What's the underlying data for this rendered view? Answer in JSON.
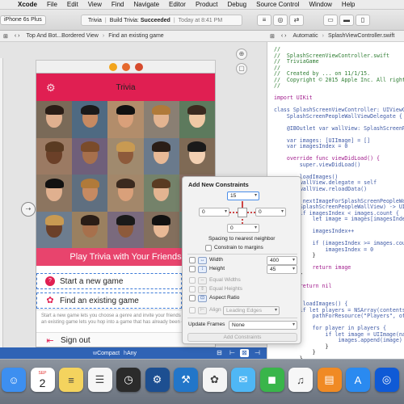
{
  "menubar": {
    "items": [
      "Xcode",
      "File",
      "Edit",
      "View",
      "Find",
      "Navigate",
      "Editor",
      "Product",
      "Debug",
      "Source Control",
      "Window",
      "Help"
    ]
  },
  "toolbar": {
    "scheme": "iPhone 6s Plus",
    "activity_app": "Trivia",
    "activity_status_prefix": "Build Trivia:",
    "activity_status": "Succeeded",
    "activity_time": "Today at 8:41 PM"
  },
  "jumpbar_left": [
    "Top And Bot...Bordered View",
    "Find an existing game"
  ],
  "jumpbar_right": [
    "Automatic",
    "SplashViewController.swift"
  ],
  "storyboard": {
    "nav_title": "Trivia",
    "banner_title": "Play Trivia with Your Friends",
    "menu_start": "Start a new game",
    "menu_find": "Find an existing game",
    "description": "Start a new game lets you choose a genre and invite your friends to play. Find an existing game lets you hop into a game that has already been created.",
    "sign_out": "Sign out",
    "size_class_prefix": "w",
    "size_class_w": "Compact",
    "size_class_h_prefix": "h",
    "size_class_h": "Any"
  },
  "constraints_popover": {
    "title": "Add New Constraints",
    "top_value": "15",
    "left_value": "0",
    "right_value": "0",
    "bottom_value": "0",
    "spacing_label": "Spacing to nearest neighbor",
    "margins_label": "Constrain to margins",
    "width_label": "Width",
    "width_value": "400",
    "height_label": "Height",
    "height_value": "45",
    "equal_widths": "Equal Widths",
    "equal_heights": "Equal Heights",
    "aspect_ratio": "Aspect Ratio",
    "align_label": "Align",
    "align_value": "Leading Edges",
    "update_frames_label": "Update Frames",
    "update_frames_value": "None",
    "add_button": "Add Constraints"
  },
  "code_lines": [
    {
      "cls": "c-com",
      "text": "//"
    },
    {
      "cls": "c-com",
      "text": "//  SplashScreenViewController.swift"
    },
    {
      "cls": "c-com",
      "text": "//  TriviaGame"
    },
    {
      "cls": "c-com",
      "text": "//"
    },
    {
      "cls": "c-com",
      "text": "//  Created by ... on 11/1/15."
    },
    {
      "cls": "c-com",
      "text": "//  Copyright © 2015 Apple Inc. All rights r"
    },
    {
      "cls": "c-com",
      "text": "//"
    },
    {
      "cls": "c-pln",
      "text": ""
    },
    {
      "cls": "c-kw",
      "text": "import UIKit"
    },
    {
      "cls": "c-pln",
      "text": ""
    },
    {
      "cls": "c-typ",
      "text": "class SplashScreenViewController: UIViewCont"
    },
    {
      "cls": "c-typ",
      "text": "    SplashScreenPeopleWallViewDelegate {"
    },
    {
      "cls": "c-pln",
      "text": ""
    },
    {
      "cls": "c-typ",
      "text": "    @IBOutlet var wallView: SplashScreenPeop"
    },
    {
      "cls": "c-pln",
      "text": ""
    },
    {
      "cls": "c-typ",
      "text": "    var images: [UIImage] = []"
    },
    {
      "cls": "c-typ",
      "text": "    var imagesIndex = 0"
    },
    {
      "cls": "c-pln",
      "text": ""
    },
    {
      "cls": "c-kw",
      "text": "    override func viewDidLoad() {"
    },
    {
      "cls": "c-typ",
      "text": "        super.viewDidLoad()"
    },
    {
      "cls": "c-pln",
      "text": ""
    },
    {
      "cls": "c-typ",
      "text": "        loadImages()"
    },
    {
      "cls": "c-typ",
      "text": "        wallView.delegate = self"
    },
    {
      "cls": "c-typ",
      "text": "        wallView.reloadData()"
    },
    {
      "cls": "c-pln",
      "text": "    }"
    },
    {
      "cls": "c-typ",
      "text": "    func nextImageForSplashScreenPeopleWall"
    },
    {
      "cls": "c-typ",
      "text": "        SplashScreenPeopleWallView) -> UIIm"
    },
    {
      "cls": "c-typ",
      "text": "        if imagesIndex < images.count {"
    },
    {
      "cls": "c-typ",
      "text": "            let image = images[imagesIndex]"
    },
    {
      "cls": "c-pln",
      "text": ""
    },
    {
      "cls": "c-typ",
      "text": "            imagesIndex++"
    },
    {
      "cls": "c-pln",
      "text": ""
    },
    {
      "cls": "c-typ",
      "text": "            if (imagesIndex >= images.count)"
    },
    {
      "cls": "c-typ",
      "text": "                imagesIndex = 0"
    },
    {
      "cls": "c-pln",
      "text": "            }"
    },
    {
      "cls": "c-pln",
      "text": ""
    },
    {
      "cls": "c-kw",
      "text": "            return image"
    },
    {
      "cls": "c-pln",
      "text": "        }"
    },
    {
      "cls": "c-pln",
      "text": ""
    },
    {
      "cls": "c-kw",
      "text": "        return nil"
    },
    {
      "cls": "c-pln",
      "text": "    }"
    },
    {
      "cls": "c-pln",
      "text": ""
    },
    {
      "cls": "c-typ",
      "text": "    func loadImages() {"
    },
    {
      "cls": "c-typ",
      "text": "        if let players = NSArray(contentsOfF"
    },
    {
      "cls": "c-typ",
      "text": "            pathForResource(\"Players\", ofTyp"
    },
    {
      "cls": "c-pln",
      "text": ""
    },
    {
      "cls": "c-typ",
      "text": "            for player in players {"
    },
    {
      "cls": "c-typ",
      "text": "                if let image = UIImage(named"
    },
    {
      "cls": "c-typ",
      "text": "                    images.append(image)"
    },
    {
      "cls": "c-pln",
      "text": "                }"
    },
    {
      "cls": "c-pln",
      "text": "            }"
    },
    {
      "cls": "c-pln",
      "text": "        }"
    }
  ],
  "dock": {
    "calendar_month": "SEP",
    "calendar_day": "2",
    "apps": [
      {
        "name": "finder-icon",
        "color": "#3d8ff0",
        "glyph": "☺"
      },
      {
        "name": "calendar-icon",
        "color": "#ffffff",
        "glyph": ""
      },
      {
        "name": "notes-icon",
        "color": "#f4d35e",
        "glyph": "≡"
      },
      {
        "name": "reminders-icon",
        "color": "#f6f6f6",
        "glyph": "☰"
      },
      {
        "name": "dashboard-icon",
        "color": "#2b2b2b",
        "glyph": "◷"
      },
      {
        "name": "instruments-icon",
        "color": "#1d4f91",
        "glyph": "⚙"
      },
      {
        "name": "xcode-icon",
        "color": "#2276c9",
        "glyph": "⚒"
      },
      {
        "name": "photos-icon",
        "color": "#f4f4f4",
        "glyph": "✿"
      },
      {
        "name": "messages-icon",
        "color": "#4fb7f5",
        "glyph": "✉"
      },
      {
        "name": "facetime-icon",
        "color": "#39b54a",
        "glyph": "◼"
      },
      {
        "name": "itunes-icon",
        "color": "#f7f7f7",
        "glyph": "♫"
      },
      {
        "name": "ibooks-icon",
        "color": "#f08a24",
        "glyph": "▤"
      },
      {
        "name": "appstore-icon",
        "color": "#2a8af0",
        "glyph": "A"
      },
      {
        "name": "finder-more-icon",
        "color": "#0f5ad6",
        "glyph": "◎"
      }
    ]
  },
  "colors": {
    "accent_pink": "#e01f52",
    "size_bar_blue": "#2f63b5",
    "selection_blue": "#3d7bd8"
  }
}
